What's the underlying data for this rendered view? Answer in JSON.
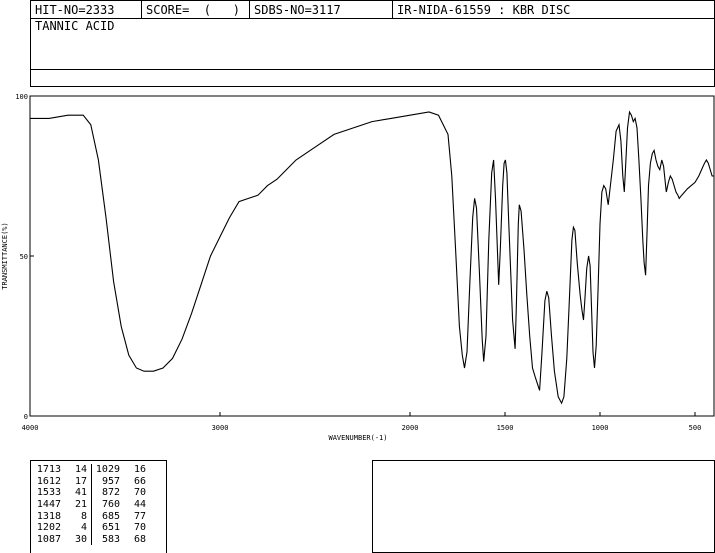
{
  "header": {
    "hit_no": "HIT-NO=2333",
    "score": "SCORE=  (   )",
    "sdbs_no": "SDBS-NO=3117",
    "ir_id": "IR-NIDA-61559 : KBR DISC"
  },
  "compound_name": "TANNIC ACID",
  "chart_data": {
    "type": "line",
    "xlabel": "WAVENUMBER(-1)",
    "ylabel": "TRANSMITTANCE(%)",
    "xlim": [
      4000,
      400
    ],
    "ylim": [
      0,
      100
    ],
    "x_ticks": [
      "4000",
      "3000",
      "2000",
      "1500",
      "1000",
      "500"
    ],
    "x_tick_values": [
      4000,
      3000,
      2000,
      1500,
      1000,
      500
    ],
    "y_ticks": [
      "0",
      "50",
      "100"
    ],
    "y_tick_values": [
      0,
      50,
      100
    ],
    "series": [
      {
        "points": [
          [
            4000,
            93
          ],
          [
            3900,
            93
          ],
          [
            3800,
            94
          ],
          [
            3720,
            94
          ],
          [
            3680,
            91
          ],
          [
            3640,
            80
          ],
          [
            3600,
            62
          ],
          [
            3560,
            42
          ],
          [
            3520,
            28
          ],
          [
            3480,
            19
          ],
          [
            3440,
            15
          ],
          [
            3400,
            14
          ],
          [
            3350,
            14
          ],
          [
            3300,
            15
          ],
          [
            3250,
            18
          ],
          [
            3200,
            24
          ],
          [
            3150,
            32
          ],
          [
            3100,
            41
          ],
          [
            3050,
            50
          ],
          [
            3000,
            56
          ],
          [
            2950,
            62
          ],
          [
            2900,
            67
          ],
          [
            2850,
            68
          ],
          [
            2800,
            69
          ],
          [
            2750,
            72
          ],
          [
            2700,
            74
          ],
          [
            2650,
            77
          ],
          [
            2600,
            80
          ],
          [
            2500,
            84
          ],
          [
            2400,
            88
          ],
          [
            2300,
            90
          ],
          [
            2200,
            92
          ],
          [
            2100,
            93
          ],
          [
            2000,
            94
          ],
          [
            1900,
            95
          ],
          [
            1850,
            94
          ],
          [
            1800,
            88
          ],
          [
            1780,
            75
          ],
          [
            1760,
            52
          ],
          [
            1740,
            28
          ],
          [
            1725,
            19
          ],
          [
            1713,
            15
          ],
          [
            1700,
            20
          ],
          [
            1685,
            42
          ],
          [
            1670,
            62
          ],
          [
            1660,
            68
          ],
          [
            1650,
            65
          ],
          [
            1635,
            45
          ],
          [
            1620,
            24
          ],
          [
            1612,
            17
          ],
          [
            1600,
            25
          ],
          [
            1585,
            55
          ],
          [
            1570,
            76
          ],
          [
            1560,
            80
          ],
          [
            1550,
            68
          ],
          [
            1540,
            52
          ],
          [
            1533,
            41
          ],
          [
            1525,
            52
          ],
          [
            1512,
            72
          ],
          [
            1505,
            79
          ],
          [
            1498,
            80
          ],
          [
            1490,
            76
          ],
          [
            1480,
            60
          ],
          [
            1470,
            45
          ],
          [
            1460,
            30
          ],
          [
            1447,
            21
          ],
          [
            1440,
            35
          ],
          [
            1430,
            60
          ],
          [
            1425,
            66
          ],
          [
            1415,
            64
          ],
          [
            1400,
            52
          ],
          [
            1385,
            38
          ],
          [
            1370,
            25
          ],
          [
            1355,
            15
          ],
          [
            1340,
            12
          ],
          [
            1318,
            8
          ],
          [
            1305,
            20
          ],
          [
            1290,
            36
          ],
          [
            1280,
            39
          ],
          [
            1270,
            37
          ],
          [
            1255,
            25
          ],
          [
            1240,
            14
          ],
          [
            1220,
            6
          ],
          [
            1202,
            4
          ],
          [
            1190,
            6
          ],
          [
            1175,
            18
          ],
          [
            1160,
            38
          ],
          [
            1148,
            55
          ],
          [
            1140,
            59
          ],
          [
            1132,
            58
          ],
          [
            1120,
            48
          ],
          [
            1105,
            38
          ],
          [
            1095,
            33
          ],
          [
            1087,
            30
          ],
          [
            1080,
            36
          ],
          [
            1070,
            46
          ],
          [
            1060,
            50
          ],
          [
            1052,
            47
          ],
          [
            1045,
            35
          ],
          [
            1037,
            20
          ],
          [
            1029,
            15
          ],
          [
            1020,
            22
          ],
          [
            1010,
            40
          ],
          [
            1000,
            60
          ],
          [
            990,
            70
          ],
          [
            980,
            72
          ],
          [
            970,
            71
          ],
          [
            957,
            66
          ],
          [
            945,
            72
          ],
          [
            930,
            80
          ],
          [
            915,
            89
          ],
          [
            900,
            91
          ],
          [
            890,
            86
          ],
          [
            880,
            75
          ],
          [
            872,
            70
          ],
          [
            865,
            78
          ],
          [
            855,
            90
          ],
          [
            845,
            95
          ],
          [
            835,
            94
          ],
          [
            825,
            92
          ],
          [
            815,
            93
          ],
          [
            805,
            90
          ],
          [
            795,
            80
          ],
          [
            785,
            68
          ],
          [
            775,
            55
          ],
          [
            768,
            48
          ],
          [
            760,
            44
          ],
          [
            752,
            58
          ],
          [
            745,
            72
          ],
          [
            735,
            79
          ],
          [
            725,
            82
          ],
          [
            715,
            83
          ],
          [
            705,
            80
          ],
          [
            695,
            78
          ],
          [
            685,
            77
          ],
          [
            675,
            80
          ],
          [
            665,
            78
          ],
          [
            655,
            72
          ],
          [
            651,
            70
          ],
          [
            640,
            73
          ],
          [
            630,
            75
          ],
          [
            620,
            74
          ],
          [
            610,
            72
          ],
          [
            600,
            70
          ],
          [
            590,
            69
          ],
          [
            583,
            68
          ],
          [
            570,
            69
          ],
          [
            555,
            70
          ],
          [
            540,
            71
          ],
          [
            520,
            72
          ],
          [
            500,
            73
          ],
          [
            480,
            75
          ],
          [
            465,
            77
          ],
          [
            450,
            79
          ],
          [
            440,
            80
          ],
          [
            430,
            79
          ],
          [
            420,
            77
          ],
          [
            410,
            75
          ],
          [
            400,
            75
          ]
        ]
      }
    ]
  },
  "peak_table": {
    "rows": [
      [
        "1713",
        "14",
        "1029",
        "16"
      ],
      [
        "1612",
        "17",
        "957",
        "66"
      ],
      [
        "1533",
        "41",
        "872",
        "70"
      ],
      [
        "1447",
        "21",
        "760",
        "44"
      ],
      [
        "1318",
        "8",
        "685",
        "77"
      ],
      [
        "1202",
        "4",
        "651",
        "70"
      ],
      [
        "1087",
        "30",
        "583",
        "68"
      ]
    ]
  }
}
